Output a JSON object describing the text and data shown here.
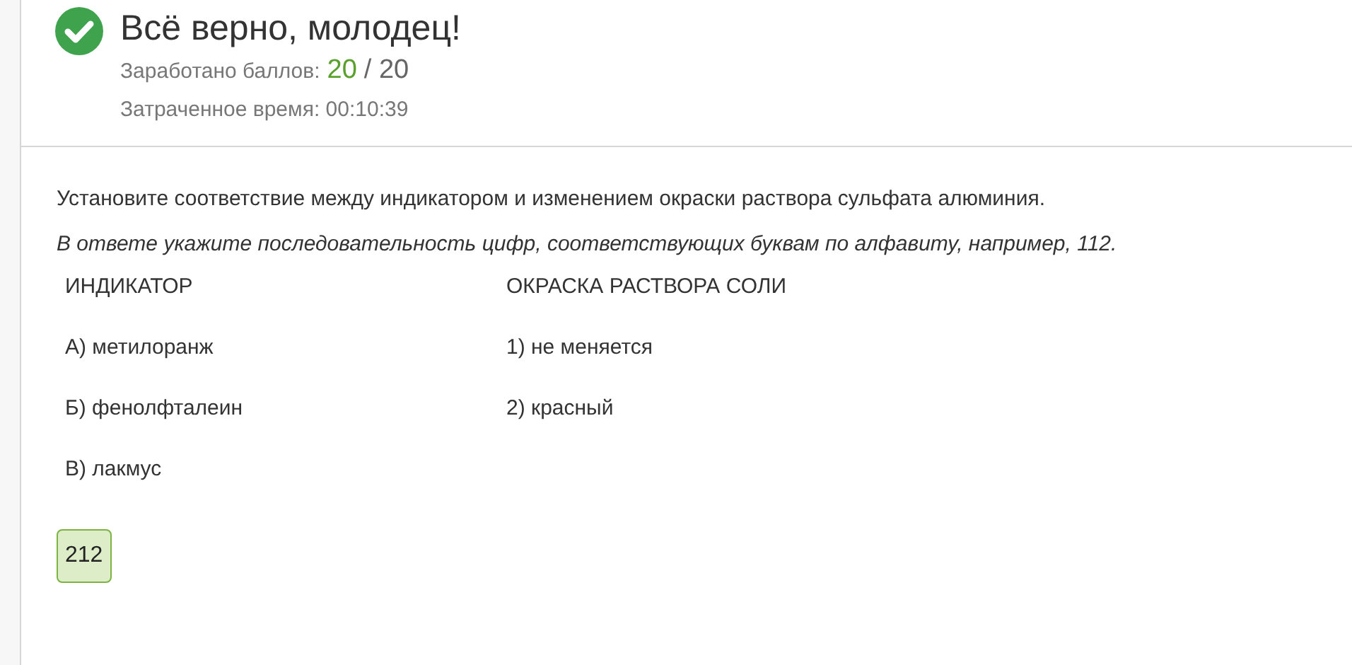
{
  "result": {
    "title": "Всё верно, молодец!",
    "score_label": "Заработано баллов:",
    "score": "20",
    "score_max": "/ 20",
    "time": "Затраченное время: 00:10:39"
  },
  "question": {
    "text": "Установите соответствие между индикатором и изменением окраски раствора сульфата алюминия.",
    "hint": "В ответе укажите последовательность цифр, соответствующих буквам по алфавиту, например, 112.",
    "columns": [
      "ИНДИКАТОР",
      "ОКРАСКА РАСТВОРА СОЛИ"
    ],
    "rows": [
      [
        "А) метилоранж",
        "1) не меняется"
      ],
      [
        "Б) фенолфталеин",
        "2) красный"
      ],
      [
        "В) лакмус",
        ""
      ]
    ]
  },
  "answer": {
    "value": "212",
    "correct": true
  }
}
